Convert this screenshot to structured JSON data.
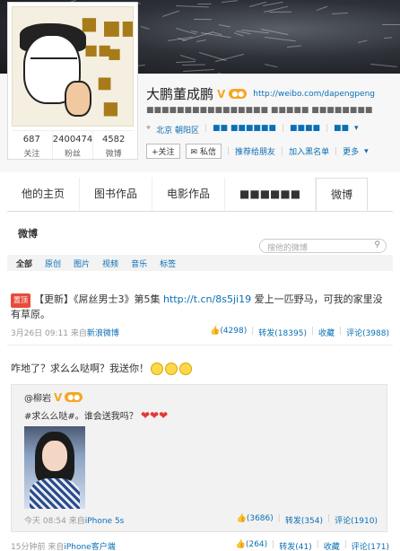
{
  "profile": {
    "name": "大鹏董成鹏",
    "verified_badge": "V",
    "blog_url": "http://weibo.com/dapengpeng",
    "work_contact": "■■■■■■■■■■■■■■■■ ■■■■■ ■■■■■■■■",
    "location": "北京 朝阳区",
    "school": "■■ ■■■■■■",
    "company": "■■■■",
    "tags": "■■",
    "avatar_calligraphy": [
      "■",
      "■■",
      "■■",
      "■",
      "■",
      "■"
    ],
    "stats": [
      {
        "num": "687",
        "label": "关注"
      },
      {
        "num": "2400474",
        "label": "粉丝"
      },
      {
        "num": "4582",
        "label": "微博"
      }
    ],
    "actions": {
      "follow": "+关注",
      "message": "私信",
      "recommend": "推荐给朋友",
      "blacklist": "加入黑名单",
      "more": "更多"
    }
  },
  "tabs": [
    "他的主页",
    "图书作品",
    "电影作品",
    "■■■■■■",
    "微博"
  ],
  "feed": {
    "section_title": "微博",
    "search_placeholder": "搜他的微博",
    "filters": [
      "全部",
      "原创",
      "图片",
      "视频",
      "音乐",
      "标签"
    ]
  },
  "post1": {
    "badge": "置顶",
    "text_prefix": "【更新】《屌丝男士3》第5集 ",
    "link": "http://t.cn/8s5ji19",
    "text_suffix": " 爱上一匹野马，可我的家里没有草原。",
    "time": "3月26日 09:11",
    "source_prefix": "来自",
    "source": "新浪微博",
    "likes": "(4298)",
    "repost": "转发(18395)",
    "fav": "收藏",
    "comment": "评论(3988)"
  },
  "post2": {
    "text": "咋地了？求么么哒啊？我送你！",
    "repost_user": "@柳岩",
    "repost_text": "#求么么哒#。谁会送我吗？",
    "repost_time": "今天 08:54",
    "repost_source_prefix": "来自",
    "repost_source": "iPhone 5s",
    "repost_likes": "(3686)",
    "repost_repost": "转发(354)",
    "repost_comment": "评论(1910)",
    "time": "15分钟前",
    "source_prefix": "来自",
    "source": "iPhone客户端",
    "likes": "(264)",
    "repost": "转发(41)",
    "fav": "收藏",
    "comment": "评论(171)"
  }
}
